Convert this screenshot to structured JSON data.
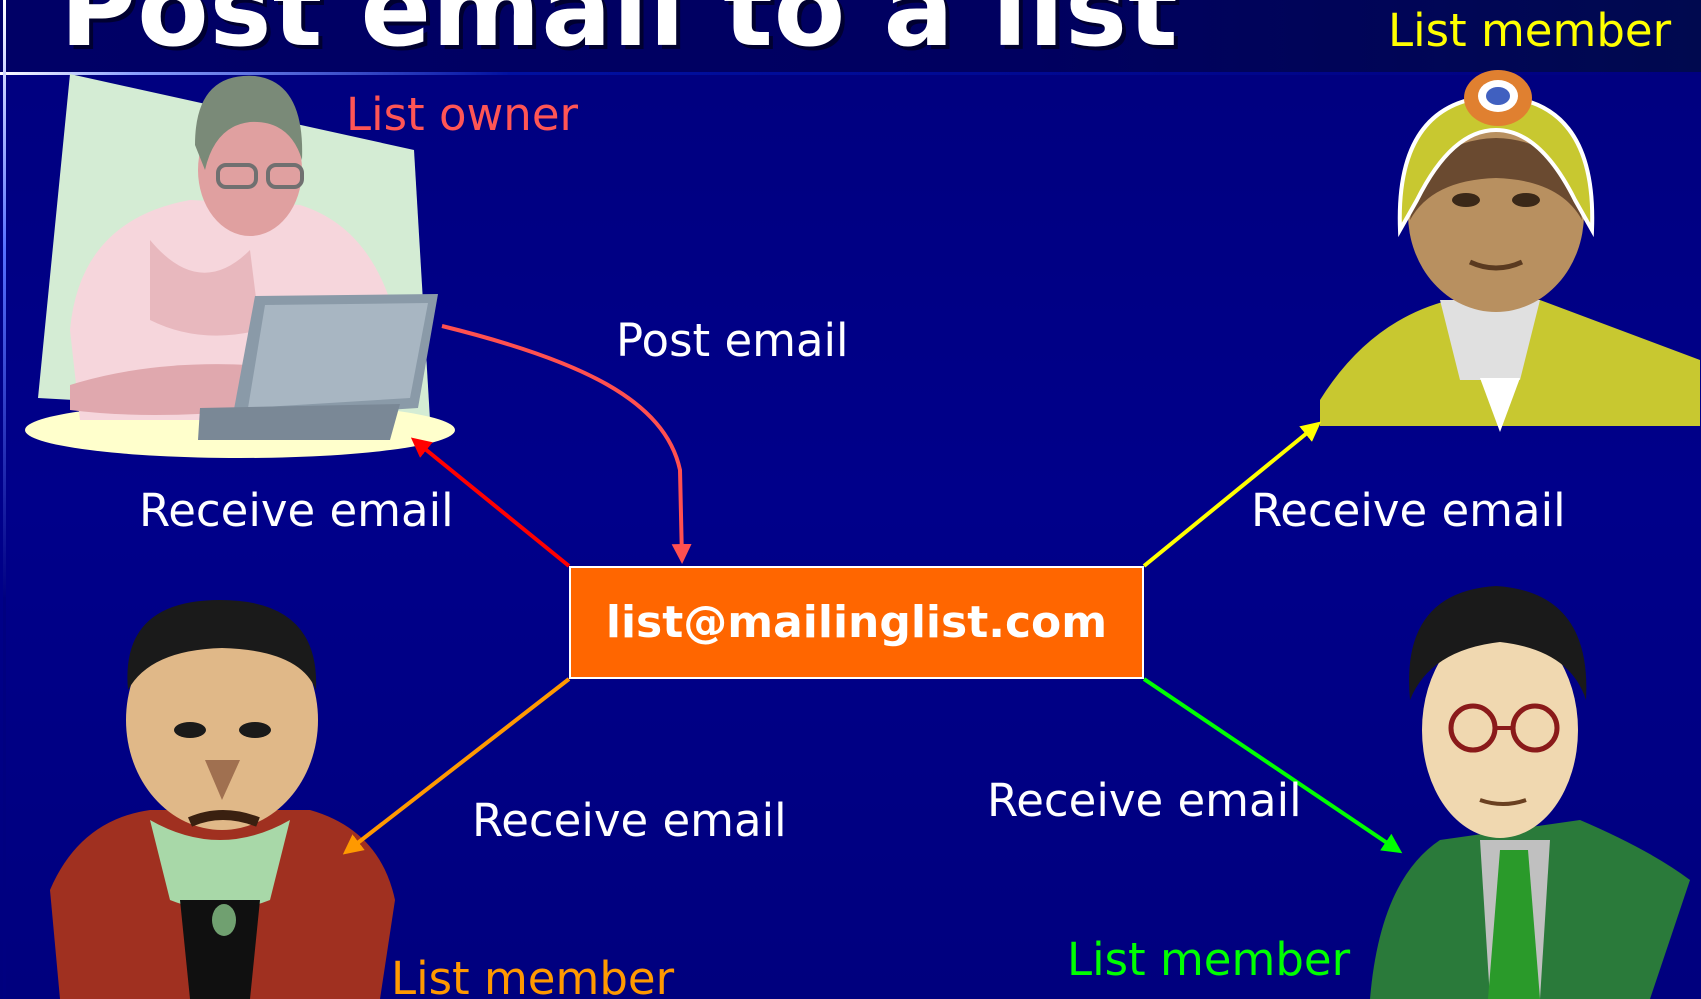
{
  "slide": {
    "title": "Post email to a list"
  },
  "hub": {
    "address": "list@mailinglist.com",
    "color": "#ff6600"
  },
  "roles": {
    "owner": {
      "label": "List owner",
      "color": "#ff5555"
    },
    "member_top_right": {
      "label": "List member",
      "color": "#ffff00"
    },
    "member_bottom_left": {
      "label": "List member",
      "color": "#ff9900"
    },
    "member_bottom_right": {
      "label": "List member",
      "color": "#00ff00"
    }
  },
  "edges": {
    "post": {
      "label": "Post email",
      "color": "#ff5050"
    },
    "receive_owner": {
      "label": "Receive email",
      "color": "#ff0000"
    },
    "receive_top_right": {
      "label": "Receive email",
      "color": "#ffff00"
    },
    "receive_bottom_left": {
      "label": "Receive email",
      "color": "#ff9900"
    },
    "receive_bottom_right": {
      "label": "Receive email",
      "color": "#00ff00"
    }
  },
  "icons": [
    "person-at-laptop-icon",
    "miner-with-helmet-icon",
    "man-in-red-coat-icon",
    "man-with-glasses-icon"
  ]
}
